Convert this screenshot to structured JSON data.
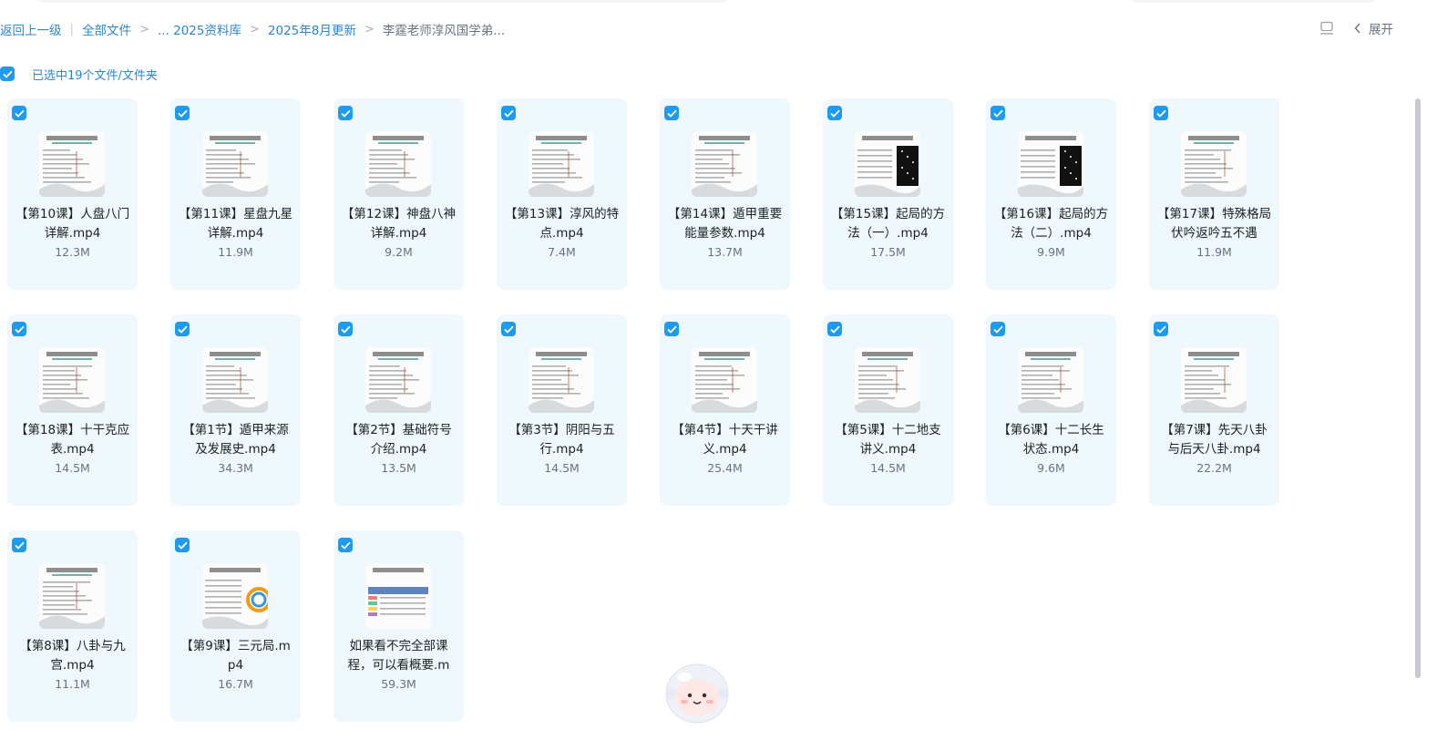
{
  "breadcrumb": {
    "back": "返回上一级",
    "all_files": "全部文件",
    "level1": "... 2025资料库",
    "level2": "2025年8月更新",
    "current": "李霆老师淳风国学弟..."
  },
  "toolbar": {
    "expand_label": "展开"
  },
  "selection": {
    "label": "已选中19个文件/文件夹"
  },
  "colors": {
    "accent": "#1d9bf0",
    "link": "#2a86d6",
    "card_bg": "#eef8fd"
  },
  "files": [
    {
      "name": "【第10课】人盘八门详解.mp4",
      "size": "12.3M",
      "selected": true
    },
    {
      "name": "【第11课】星盘九星详解.mp4",
      "size": "11.9M",
      "selected": true
    },
    {
      "name": "【第12课】神盘八神详解.mp4",
      "size": "9.2M",
      "selected": true
    },
    {
      "name": "【第13课】淳风的特点.mp4",
      "size": "7.4M",
      "selected": true
    },
    {
      "name": "【第14课】遁甲重要能量参数.mp4",
      "size": "13.7M",
      "selected": true
    },
    {
      "name": "【第15课】起局的方法（一）.mp4",
      "size": "17.5M",
      "selected": true
    },
    {
      "name": "【第16课】起局的方法（二）.mp4",
      "size": "9.9M",
      "selected": true
    },
    {
      "name": "【第17课】特殊格局伏吟返吟五不遇",
      "size": "11.9M",
      "selected": true
    },
    {
      "name": "【第18课】十干克应表.mp4",
      "size": "14.5M",
      "selected": true
    },
    {
      "name": "【第1节】遁甲来源及发展史.mp4",
      "size": "34.3M",
      "selected": true
    },
    {
      "name": "【第2节】基础符号介绍.mp4",
      "size": "13.5M",
      "selected": true
    },
    {
      "name": "【第3节】阴阳与五行.mp4",
      "size": "14.5M",
      "selected": true
    },
    {
      "name": "【第4节】十天干讲义.mp4",
      "size": "25.4M",
      "selected": true
    },
    {
      "name": "【第5课】十二地支讲义.mp4",
      "size": "14.5M",
      "selected": true
    },
    {
      "name": "【第6课】十二长生状态.mp4",
      "size": "9.6M",
      "selected": true
    },
    {
      "name": "【第7课】先天八卦与后天八卦.mp4",
      "size": "22.2M",
      "selected": true
    },
    {
      "name": "【第8课】八卦与九宫.mp4",
      "size": "11.1M",
      "selected": true
    },
    {
      "name": "【第9课】三元局.mp4",
      "size": "16.7M",
      "selected": true
    },
    {
      "name": "如果看不完全部课程，可以看概要.m",
      "size": "59.3M",
      "selected": true
    }
  ]
}
